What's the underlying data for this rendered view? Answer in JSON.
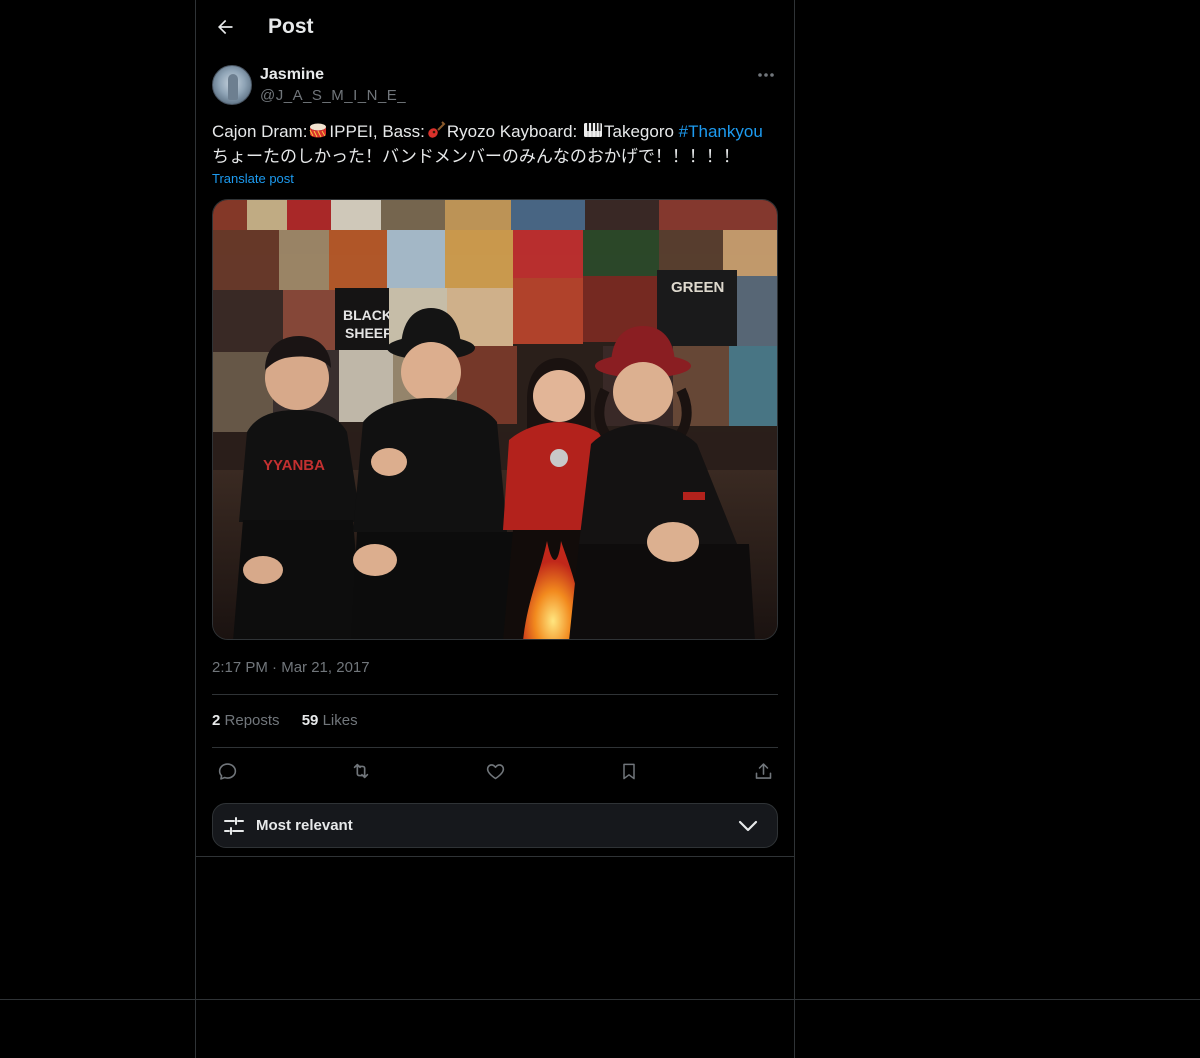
{
  "header": {
    "title": "Post",
    "back_icon": "arrow-left-icon"
  },
  "author": {
    "name": "Jasmine",
    "handle": "@J_A_S_M_I_N_E_"
  },
  "post": {
    "line1_part1": "Cajon Dram:",
    "line1_part2": "IPPEI, Bass:",
    "line1_part3": "Ryozo Kayboard: ",
    "line1_part4": "Takegoro ",
    "hashtag": "#Thankyou",
    "line2": "ちょーたのしかった！バンドメンバーのみんなのおかげで！！！！！",
    "translate_label": "Translate post",
    "emoji": [
      "drum-icon",
      "guitar-icon",
      "piano-keys-icon"
    ]
  },
  "media": {
    "alt": "Four band members posing in front of a wall of vinyl record covers"
  },
  "meta": {
    "time": "2:17 PM",
    "dot": "·",
    "date": "Mar 21, 2017"
  },
  "stats": {
    "reposts_count": "2",
    "reposts_label": "Reposts",
    "likes_count": "59",
    "likes_label": "Likes"
  },
  "actions": [
    "reply-icon",
    "repost-icon",
    "like-icon",
    "bookmark-icon",
    "share-icon"
  ],
  "sort": {
    "label": "Most relevant"
  },
  "colors": {
    "background": "#000000",
    "text": "#e7e9ea",
    "secondary": "#71767b",
    "accent": "#1d9bf0",
    "border": "#2f3336"
  }
}
